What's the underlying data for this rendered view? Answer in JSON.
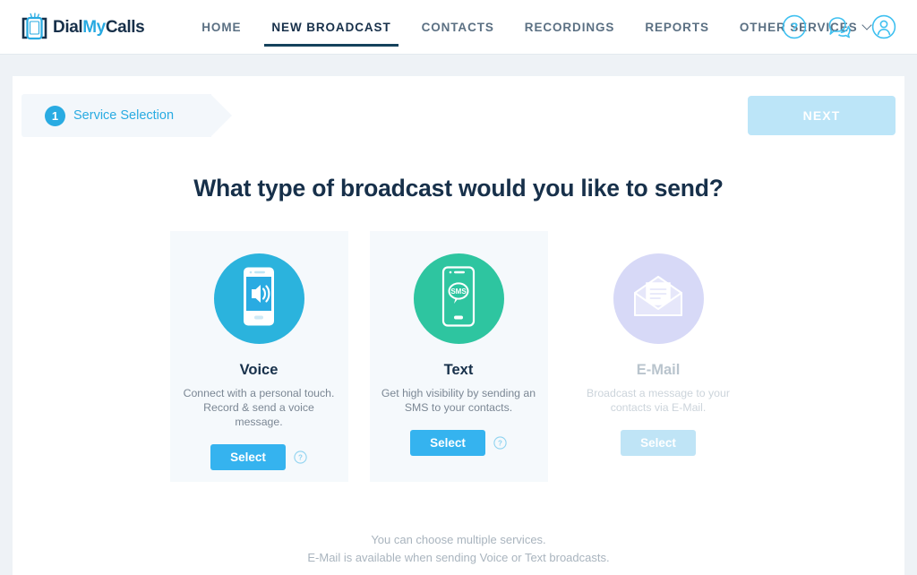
{
  "brand": {
    "logo_icon": "mobile-phone-icon",
    "name_part1": "Dial",
    "name_part2": "My",
    "name_part3": "Calls",
    "color_primary": "#29abe2",
    "color_dark": "#17304a"
  },
  "nav": {
    "items": [
      {
        "label": "HOME",
        "active": false
      },
      {
        "label": "NEW BROADCAST",
        "active": true
      },
      {
        "label": "CONTACTS",
        "active": false
      },
      {
        "label": "RECORDINGS",
        "active": false
      },
      {
        "label": "REPORTS",
        "active": false
      },
      {
        "label": "OTHER SERVICES",
        "active": false,
        "has_caret": true
      }
    ],
    "icons": [
      {
        "name": "help-circle-icon",
        "glyph": "?"
      },
      {
        "name": "chat-bubbles-icon",
        "glyph": "chat"
      },
      {
        "name": "user-account-icon",
        "glyph": "person"
      }
    ]
  },
  "step": {
    "number": "1",
    "label": "Service Selection",
    "next_label": "NEXT"
  },
  "main": {
    "headline": "What type of broadcast would you like to send?",
    "cards": [
      {
        "id": "voice",
        "icon": "phone-speaker-icon",
        "circle_color": "#2bb3dd",
        "title": "Voice",
        "desc_line1": "Connect with a personal touch.",
        "desc_line2": "Record & send a voice message.",
        "select_label": "Select",
        "help_icon": "help-circle-icon",
        "disabled": false
      },
      {
        "id": "text",
        "icon": "phone-sms-bubble-icon",
        "circle_color": "#2ec5a0",
        "title": "Text",
        "desc_line1": "Get high visibility by sending an",
        "desc_line2": "SMS to your contacts.",
        "select_label": "Select",
        "help_icon": "help-circle-icon",
        "disabled": false
      },
      {
        "id": "email",
        "icon": "open-envelope-letter-icon",
        "circle_color": "#d7d9f7",
        "title": "E-Mail",
        "desc_line1": "Broadcast a message to your",
        "desc_line2": "contacts via E-Mail.",
        "select_label": "Select",
        "help_icon": "",
        "disabled": true
      }
    ],
    "footnote_line1": "You can choose multiple services.",
    "footnote_line2": "E-Mail is available when sending Voice or Text broadcasts."
  }
}
